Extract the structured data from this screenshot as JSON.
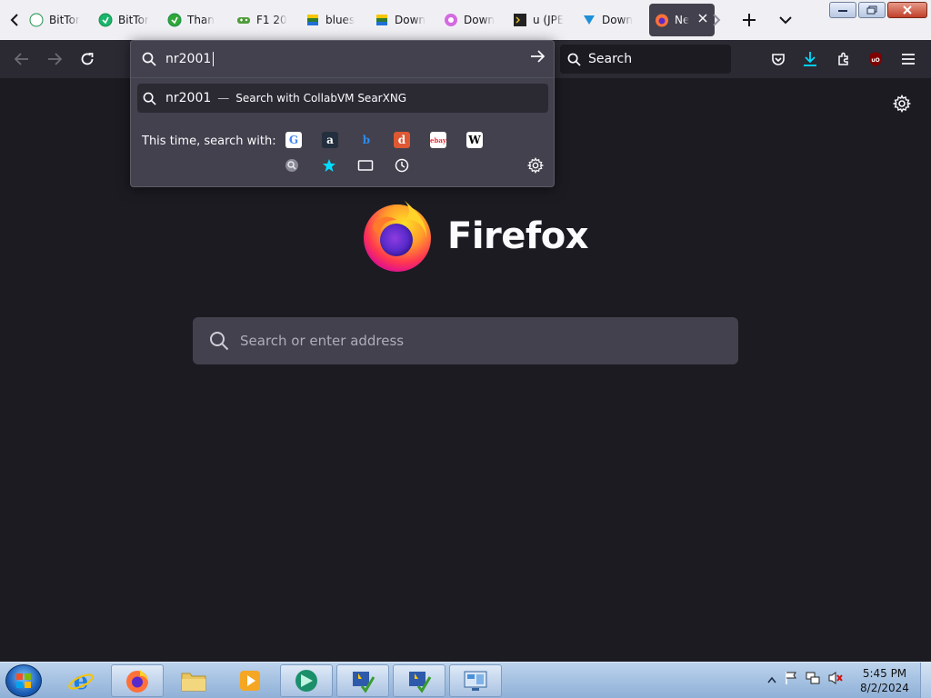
{
  "tabs": [
    {
      "title": "BitTor",
      "fav": "green-circle",
      "color": "#ffffff",
      "active": false
    },
    {
      "title": "BitTor",
      "fav": "green-circle",
      "color": "#1ab56b",
      "active": false
    },
    {
      "title": "Than",
      "fav": "utorrent",
      "color": "#2fa635",
      "active": false
    },
    {
      "title": "F1 20",
      "fav": "gamepad",
      "color": "#4f9c3a",
      "active": false
    },
    {
      "title": "blues",
      "fav": "bluestacks",
      "color": "#2f7b2f",
      "active": false
    },
    {
      "title": "Down",
      "fav": "bluestacks",
      "color": "#2f7b2f",
      "active": false
    },
    {
      "title": "Down",
      "fav": "pinwheel",
      "color": "#d46ae0",
      "active": false
    },
    {
      "title": "u (JPE",
      "fav": "terminal",
      "color": "#222222",
      "active": false
    },
    {
      "title": "Down",
      "fav": "arrow-down",
      "color": "#1e90d8",
      "active": false
    },
    {
      "title": "Ne",
      "fav": "firefox",
      "color": "#ff7139",
      "active": true
    }
  ],
  "navbar": {
    "search_placeholder": "Search"
  },
  "urlbar": {
    "typed": "nr2001",
    "suggestion_query": "nr2001",
    "suggestion_dash": "—",
    "suggestion_action": "Search with CollabVM SearXNG",
    "oneoff_label": "This time, search with:",
    "engines": [
      {
        "name": "google",
        "glyph": "G",
        "color": "#4285f4",
        "bg": "#ffffff"
      },
      {
        "name": "amazon",
        "glyph": "a",
        "color": "#ffffff",
        "bg": "#232f3e"
      },
      {
        "name": "bing",
        "glyph": "b",
        "color": "#2b8bf0",
        "bg": "transparent"
      },
      {
        "name": "duckduckgo",
        "glyph": "d",
        "color": "#ffffff",
        "bg": "#de5833"
      },
      {
        "name": "ebay",
        "glyph": "ebay",
        "color": "#e53238",
        "bg": "#ffffff"
      },
      {
        "name": "wikipedia",
        "glyph": "W",
        "color": "#000000",
        "bg": "#ffffff"
      }
    ],
    "modes": [
      "searxng-icon",
      "bookmarks-star-icon",
      "tabs-icon",
      "history-clock-icon"
    ]
  },
  "ntp": {
    "wordmark": "Firefox",
    "search_placeholder": "Search or enter address"
  },
  "taskbar": {
    "time": "5:45 PM",
    "date": "8/2/2024"
  }
}
